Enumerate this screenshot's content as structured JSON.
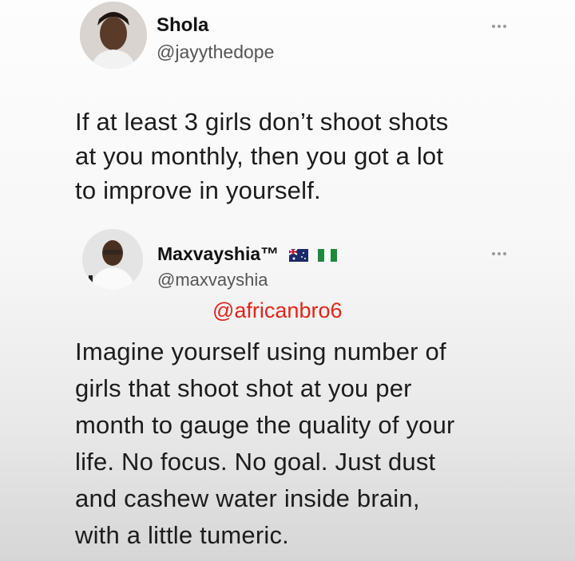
{
  "original_tweet": {
    "author_name": "Shola",
    "author_handle": "@jayythedope",
    "avatar_icon": "profile-photo-icon",
    "more_icon": "more-options-icon",
    "text_lines": [
      "If at least 3 girls don’t shoot shots",
      "at you monthly, then you got a lot",
      "to improve in yourself."
    ]
  },
  "reply_tweet": {
    "author_name": "Maxvayshia™",
    "author_handle": "@maxvayshia",
    "avatar_icon": "profile-photo-icon",
    "more_icon": "more-options-icon",
    "flags": [
      "australia-flag-icon",
      "nigeria-flag-icon"
    ],
    "text_lines": [
      "Imagine yourself using number of",
      "girls that shoot shot at you per",
      "month to gauge the quality of your",
      "life. No focus. No goal. Just dust",
      "and cashew water inside brain,",
      "with a little tumeric."
    ]
  },
  "watermark": {
    "text": "@africanbro6",
    "color": "#e0261b"
  }
}
